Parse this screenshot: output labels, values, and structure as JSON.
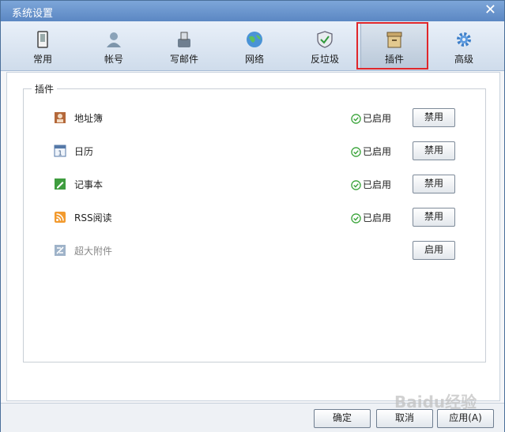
{
  "window": {
    "title": "系统设置",
    "close_symbol": "✕"
  },
  "tabs": [
    {
      "label": "常用",
      "icon": "phone-icon"
    },
    {
      "label": "帐号",
      "icon": "user-icon"
    },
    {
      "label": "写邮件",
      "icon": "compose-icon"
    },
    {
      "label": "网络",
      "icon": "globe-icon"
    },
    {
      "label": "反垃圾",
      "icon": "shield-icon"
    },
    {
      "label": "插件",
      "icon": "box-icon",
      "active": true
    },
    {
      "label": "高级",
      "icon": "gear-icon"
    }
  ],
  "plugins": {
    "group_title": "插件",
    "items": [
      {
        "name": "地址簿",
        "icon": "address-book-icon",
        "status": "已启用",
        "action": "禁用",
        "enabled": true
      },
      {
        "name": "日历",
        "icon": "calendar-icon",
        "status": "已启用",
        "action": "禁用",
        "enabled": true
      },
      {
        "name": "记事本",
        "icon": "notepad-icon",
        "status": "已启用",
        "action": "禁用",
        "enabled": true
      },
      {
        "name": "RSS阅读",
        "icon": "rss-icon",
        "status": "已启用",
        "action": "禁用",
        "enabled": true
      },
      {
        "name": "超大附件",
        "icon": "attachment-icon",
        "status": "",
        "action": "启用",
        "enabled": false
      }
    ]
  },
  "footer": {
    "ok": "确定",
    "cancel": "取消",
    "apply": "应用(A)"
  },
  "watermark": "Baidu经验",
  "colors": {
    "highlight": "#e0262a",
    "status_ok": "#3aa43a",
    "title_bar": "#6b96cf"
  }
}
